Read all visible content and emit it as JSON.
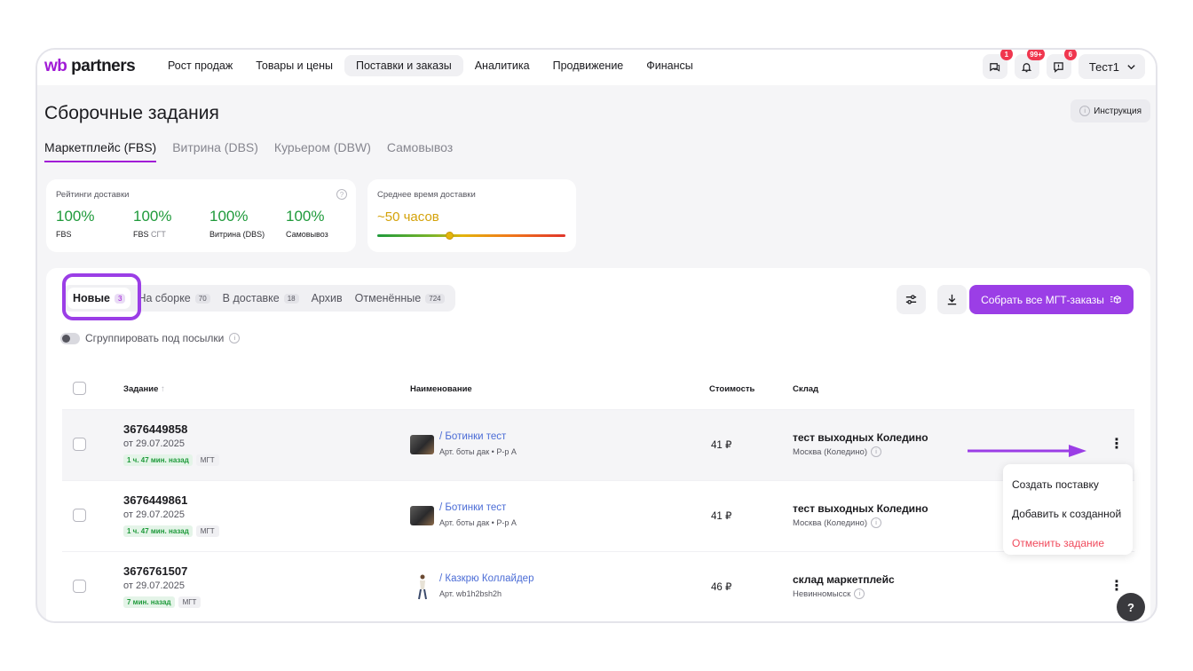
{
  "header": {
    "logo_prefix": "wb",
    "logo_suffix": " partners",
    "nav": [
      {
        "label": "Рост продаж"
      },
      {
        "label": "Товары и цены"
      },
      {
        "label": "Поставки и заказы"
      },
      {
        "label": "Аналитика"
      },
      {
        "label": "Продвижение"
      },
      {
        "label": "Финансы"
      }
    ],
    "badges": {
      "chat": "1",
      "notifications": "99+",
      "support": "6"
    },
    "user_name": "Тест1"
  },
  "page": {
    "title": "Сборочные задания",
    "instruction_label": "Инструкция",
    "sub_tabs": [
      {
        "label": "Маркетплейс (FBS)"
      },
      {
        "label": "Витрина (DBS)"
      },
      {
        "label": "Курьером (DBW)"
      },
      {
        "label": "Самовывоз"
      }
    ]
  },
  "ratings": {
    "label": "Рейтинги доставки",
    "items": [
      {
        "value": "100%",
        "label": "FBS",
        "label_muted": ""
      },
      {
        "value": "100%",
        "label": "FBS",
        "label_muted": " СГТ"
      },
      {
        "value": "100%",
        "label": "Витрина (DBS)",
        "label_muted": ""
      },
      {
        "value": "100%",
        "label": "Самовывоз",
        "label_muted": ""
      }
    ]
  },
  "delivery_time": {
    "label": "Среднее время доставки",
    "value": "~50 часов",
    "level": 0.38
  },
  "status_tabs": [
    {
      "label": "Новые",
      "count": "3"
    },
    {
      "label": "На сборке",
      "count": "70"
    },
    {
      "label": "В доставке",
      "count": "18"
    },
    {
      "label": "Архив",
      "count": ""
    },
    {
      "label": "Отменённые",
      "count": "724"
    }
  ],
  "actions": {
    "collect_all_label": "Собрать все МГТ-заказы"
  },
  "group_toggle_label": "Сгруппировать под посылки",
  "table": {
    "headers": {
      "task": "Задание",
      "name": "Наименование",
      "price": "Стоимость",
      "warehouse": "Склад"
    },
    "rows": [
      {
        "id": "3676449858",
        "date": "от 29.07.2025",
        "age": "1 ч. 47 мин. назад",
        "type": "МГТ",
        "name": "/ Ботинки тест",
        "art": "Арт. боты дак • Р-р А",
        "price": "41 ₽",
        "warehouse": "тест выходных Коледино",
        "city": "Москва (Коледино)"
      },
      {
        "id": "3676449861",
        "date": "от 29.07.2025",
        "age": "1 ч. 47 мин. назад",
        "type": "МГТ",
        "name": "/ Ботинки тест",
        "art": "Арт. боты дак • Р-р А",
        "price": "41 ₽",
        "warehouse": "тест выходных Коледино",
        "city": "Москва (Коледино)"
      },
      {
        "id": "3676761507",
        "date": "от 29.07.2025",
        "age": "7 мин. назад",
        "type": "МГТ",
        "name": "/ Казкрю Коллайдер",
        "art": "Арт. wb1h2bsh2h",
        "price": "46 ₽",
        "warehouse": "склад маркетплейс",
        "city": "Невинномысск"
      }
    ]
  },
  "context_menu": [
    {
      "label": "Создать поставку"
    },
    {
      "label": "Добавить к созданной"
    },
    {
      "label": "Отменить задание"
    }
  ],
  "help_label": "?",
  "colors": {
    "accent": "#9b3ee6",
    "brand": "#a11bd6",
    "success": "#1f9a3b",
    "danger": "#f04a5c",
    "link": "#4b6cd6"
  }
}
